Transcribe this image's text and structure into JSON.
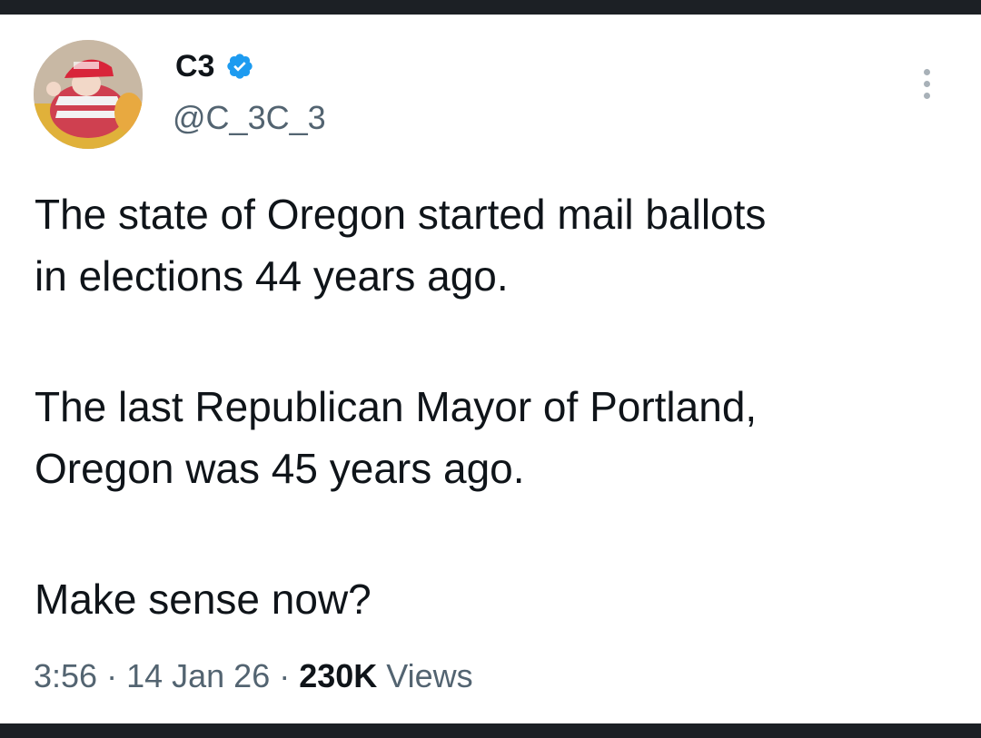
{
  "author": {
    "display_name": "C3",
    "handle": "@C_3C_3",
    "verified": true,
    "verified_icon": "verified-badge-icon",
    "avatar_icon": "avatar-photo"
  },
  "tweet": {
    "paragraphs": [
      "The state of Oregon started mail ballots\nin elections 44 years ago.",
      "The last Republican Mayor of Portland,\nOregon was 45 years ago.",
      "Make sense now?"
    ]
  },
  "meta": {
    "time": "3:56",
    "separator1": " · ",
    "date": "14 Jan 26",
    "separator2": " · ",
    "views_count": "230K",
    "views_label": " Views"
  },
  "colors": {
    "text": "#0f1419",
    "secondary": "#536471",
    "verified_blue": "#1d9bf0",
    "bar": "#1c2025"
  }
}
